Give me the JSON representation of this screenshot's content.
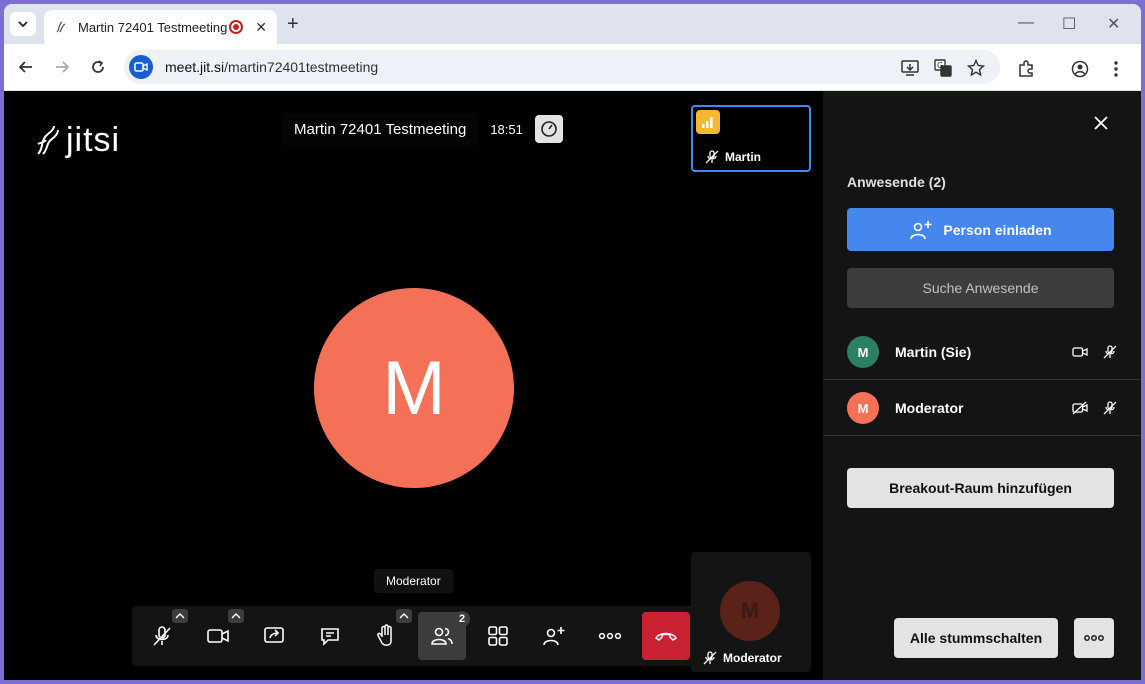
{
  "browser": {
    "tab_title": "Martin 72401 Testmeeting |",
    "tab_close": "✕",
    "new_tab": "+",
    "url_host": "meet.jit.si",
    "url_path": "/martin72401testmeeting",
    "window_controls": [
      "—",
      "☐",
      "✕"
    ]
  },
  "meeting": {
    "logo_text": "jitsi",
    "title": "Martin 72401 Testmeeting",
    "time": "18:51",
    "self_label": "Martin",
    "speaker_initial": "M",
    "tooltip": "Moderator",
    "remote_initial": "M",
    "remote_label": "Moderator",
    "participant_badge": "2"
  },
  "panel": {
    "heading": "Anwesende (2)",
    "invite_label": "Person einladen",
    "search_placeholder": "Suche Anwesende",
    "participants": [
      {
        "initial": "M",
        "name": "Martin (Sie)",
        "color": "#2a8060",
        "video": "camera-icon",
        "audio": "mic-muted-icon"
      },
      {
        "initial": "M",
        "name": "Moderator",
        "color": "#f47158",
        "video": "camera-off-icon",
        "audio": "mic-muted-icon"
      }
    ],
    "breakout_label": "Breakout-Raum hinzufügen",
    "mute_all_label": "Alle stummschalten"
  },
  "colors": {
    "accent": "#4687ed",
    "hangup": "#cb2233",
    "speaker_avatar": "#f47158",
    "connection": "#f6b731"
  }
}
